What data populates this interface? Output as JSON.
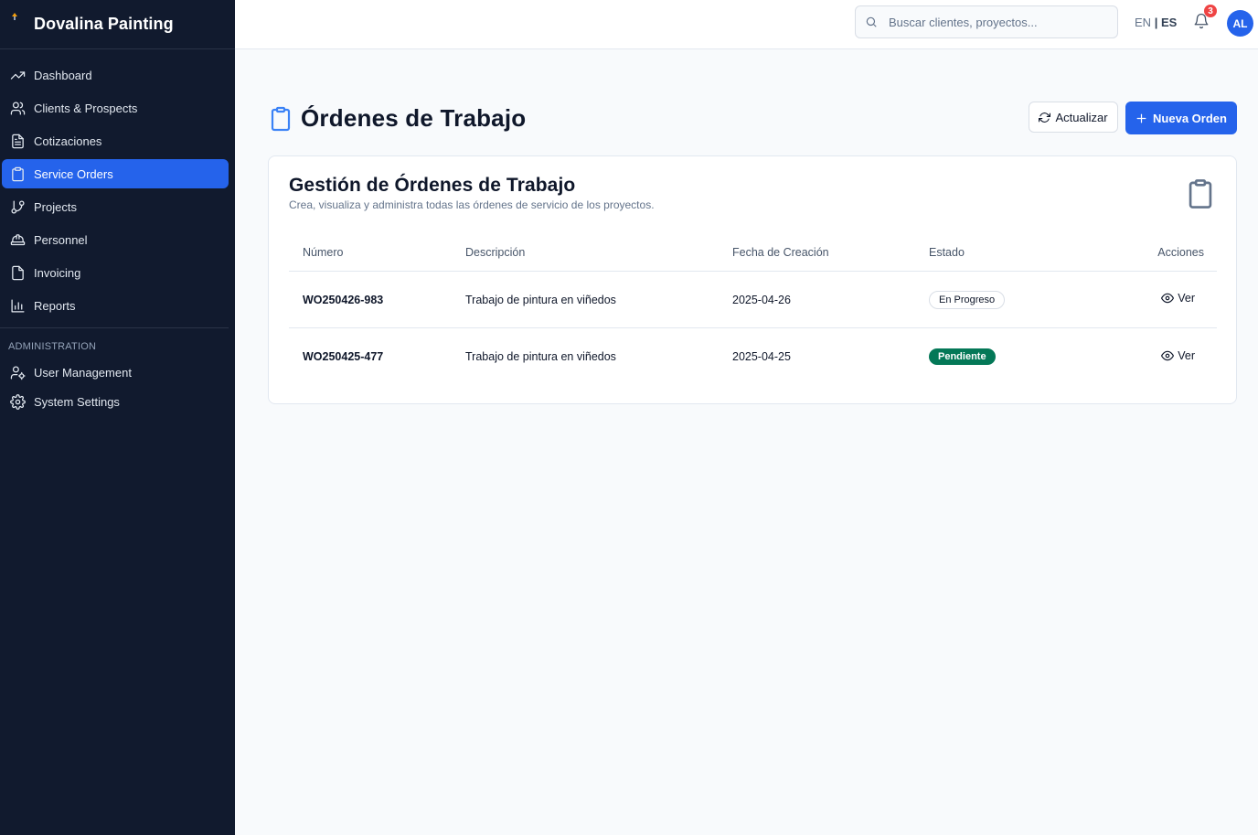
{
  "brand": {
    "name": "Dovalina Painting"
  },
  "sidebar": {
    "items": [
      {
        "label": "Dashboard",
        "icon": "trending-up-icon"
      },
      {
        "label": "Clients & Prospects",
        "icon": "users-icon"
      },
      {
        "label": "Cotizaciones",
        "icon": "file-text-icon"
      },
      {
        "label": "Service Orders",
        "icon": "clipboard-icon",
        "active": true
      },
      {
        "label": "Projects",
        "icon": "git-branch-icon"
      },
      {
        "label": "Personnel",
        "icon": "hard-hat-icon"
      },
      {
        "label": "Invoicing",
        "icon": "file-icon"
      },
      {
        "label": "Reports",
        "icon": "bar-chart-icon"
      }
    ],
    "admin_section": "ADMINISTRATION",
    "admin_items": [
      {
        "label": "User Management",
        "icon": "user-cog-icon"
      },
      {
        "label": "System Settings",
        "icon": "settings-icon"
      }
    ]
  },
  "topbar": {
    "search_placeholder": "Buscar clientes, proyectos...",
    "lang_en": "EN",
    "lang_sep": "|",
    "lang_es": "ES",
    "notifications_count": "3",
    "avatar_initials": "AL"
  },
  "page": {
    "title": "Órdenes de Trabajo",
    "refresh_label": "Actualizar",
    "new_label": "Nueva Orden"
  },
  "card": {
    "title": "Gestión de Órdenes de Trabajo",
    "subtitle": "Crea, visualiza y administra todas las órdenes de servicio de los proyectos."
  },
  "table": {
    "headers": [
      "Número",
      "Descripción",
      "Fecha de Creación",
      "Estado",
      "Acciones"
    ],
    "rows": [
      {
        "number": "WO250426-983",
        "description": "Trabajo de pintura en viñedos",
        "date": "2025-04-26",
        "status": "En Progreso",
        "action": "Ver"
      },
      {
        "number": "WO250425-477",
        "description": "Trabajo de pintura en viñedos",
        "date": "2025-04-25",
        "status": "Pendiente",
        "action": "Ver"
      }
    ]
  },
  "colors": {
    "sidebar_bg": "#111a2e",
    "accent": "#2563eb",
    "status_pending": "#047857",
    "badge_red": "#ef4444"
  }
}
